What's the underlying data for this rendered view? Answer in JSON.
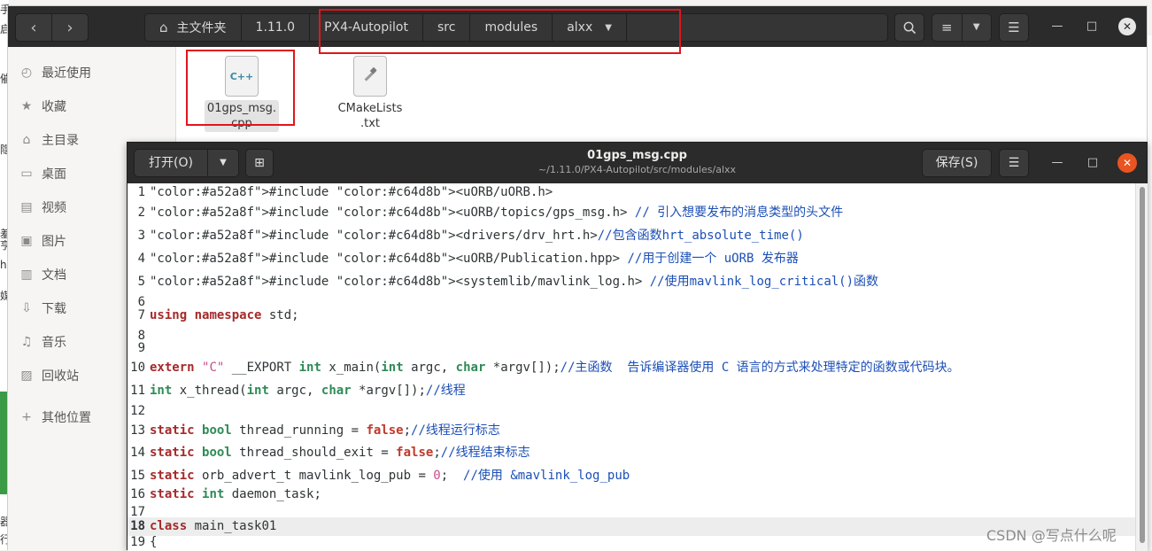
{
  "background": {
    "left_marks": [
      "手",
      "启",
      "催",
      "隐",
      "羞",
      "亨",
      "hu",
      "媒",
      "器",
      "行"
    ]
  },
  "files_window": {
    "pathbar": {
      "crumbs": [
        "主文件夹",
        "1.11.0",
        "PX4-Autopilot",
        "src",
        "modules",
        "alxx"
      ]
    },
    "sidebar": {
      "items": [
        {
          "label": "最近使用",
          "icon": "clock-icon"
        },
        {
          "label": "收藏",
          "icon": "star-icon"
        },
        {
          "label": "主目录",
          "icon": "home-icon"
        },
        {
          "label": "桌面",
          "icon": "desktop-icon"
        },
        {
          "label": "视频",
          "icon": "video-icon"
        },
        {
          "label": "图片",
          "icon": "image-icon"
        },
        {
          "label": "文档",
          "icon": "document-icon"
        },
        {
          "label": "下载",
          "icon": "download-icon"
        },
        {
          "label": "音乐",
          "icon": "music-icon"
        },
        {
          "label": "回收站",
          "icon": "trash-icon"
        },
        {
          "label": "其他位置",
          "icon": "plus-icon"
        }
      ]
    },
    "files": [
      {
        "name_line1": "01gps_msg.",
        "name_line2": "cpp",
        "icon_text": "C++",
        "selected": true
      },
      {
        "name_line1": "CMakeLists",
        "name_line2": ".txt",
        "icon_text": "",
        "selected": false
      }
    ]
  },
  "editor_window": {
    "open_label": "打开(O)",
    "title": "01gps_msg.cpp",
    "subtitle": "~/1.11.0/PX4-Autopilot/src/modules/alxx",
    "save_label": "保存(S)",
    "lines": [
      {
        "n": "1",
        "t": "#include <uORB/uORB.h>"
      },
      {
        "n": "2",
        "t": "#include <uORB/topics/gps_msg.h> // 引入想要发布的消息类型的头文件"
      },
      {
        "n": "3",
        "t": "#include <drivers/drv_hrt.h>//包含函数hrt_absolute_time()"
      },
      {
        "n": "4",
        "t": "#include <uORB/Publication.hpp> //用于创建一个 uORB 发布器"
      },
      {
        "n": "5",
        "t": "#include <systemlib/mavlink_log.h> //使用mavlink_log_critical()函数"
      },
      {
        "n": "6",
        "t": ""
      },
      {
        "n": "7",
        "t": "using namespace std;"
      },
      {
        "n": "8",
        "t": ""
      },
      {
        "n": "9",
        "t": ""
      },
      {
        "n": "10",
        "t": "extern \"C\" __EXPORT int x_main(int argc, char *argv[]);//主函数  告诉编译器使用 C 语言的方式来处理特定的函数或代码块。"
      },
      {
        "n": "11",
        "t": "int x_thread(int argc, char *argv[]);//线程"
      },
      {
        "n": "12",
        "t": ""
      },
      {
        "n": "13",
        "t": "static bool thread_running = false;//线程运行标志"
      },
      {
        "n": "14",
        "t": "static bool thread_should_exit = false;//线程结束标志"
      },
      {
        "n": "15",
        "t": "static orb_advert_t mavlink_log_pub = 0;  //使用 &mavlink_log_pub"
      },
      {
        "n": "16",
        "t": "static int daemon_task;"
      },
      {
        "n": "17",
        "t": ""
      },
      {
        "n": "18",
        "t": "class main_task01"
      },
      {
        "n": "19",
        "t": "{"
      }
    ],
    "current_line": "18"
  },
  "watermark": "CSDN @写点什么呢"
}
